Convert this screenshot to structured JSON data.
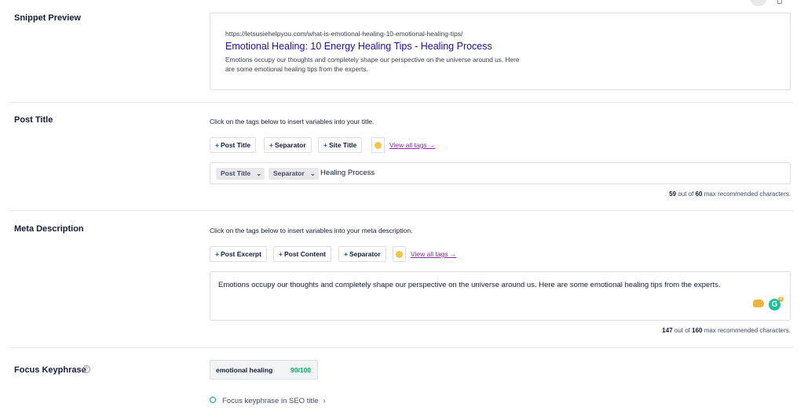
{
  "top_icons": {
    "desktop": "desktop-icon",
    "mobile": "mobile-icon"
  },
  "snippet": {
    "label": "Snippet Preview",
    "url": "https://letsusiehelpyou.com/what-is-emotional-healing-10-emotional-healing-tips/",
    "title": "Emotional Healing: 10 Energy Healing Tips - Healing Process",
    "description": "Emotions occupy our thoughts and completely shape our perspective on the universe around us. Here are some emotional healing tips from the experts."
  },
  "post_title": {
    "label": "Post Title",
    "hint": "Click on the tags below to insert variables into your title.",
    "tags": [
      "Post Title",
      "Separator",
      "Site Title"
    ],
    "view_all": "View all tags →",
    "chips": [
      "Post Title",
      "Separator"
    ],
    "text": "Healing Process",
    "count": "59",
    "count_mid": "out of",
    "max": "60",
    "count_suffix": "max recommended characters."
  },
  "meta_description": {
    "label": "Meta Description",
    "hint": "Click on the tags below to insert variables into your meta description.",
    "tags": [
      "Post Excerpt",
      "Post Content",
      "Separator"
    ],
    "view_all": "View all tags →",
    "text": "Emotions occupy our thoughts and completely shape our perspective on the universe around us. Here are some emotional healing tips from the experts.",
    "grammarly_letter": "G",
    "grammarly_badge": "2",
    "count": "147",
    "count_mid": "out of",
    "max": "160",
    "count_suffix": "max recommended characters."
  },
  "focus_keyphrase": {
    "label": "Focus Keyphrase",
    "help": "?",
    "keyphrase": "emotional healing",
    "score": "90/100",
    "check": "Focus keyphrase in SEO title",
    "chevron": "›"
  },
  "colors": {
    "link": "#1a0dab",
    "plus": "#005ae0",
    "view_all": "#8a2ba3",
    "good": "#00aa63"
  }
}
